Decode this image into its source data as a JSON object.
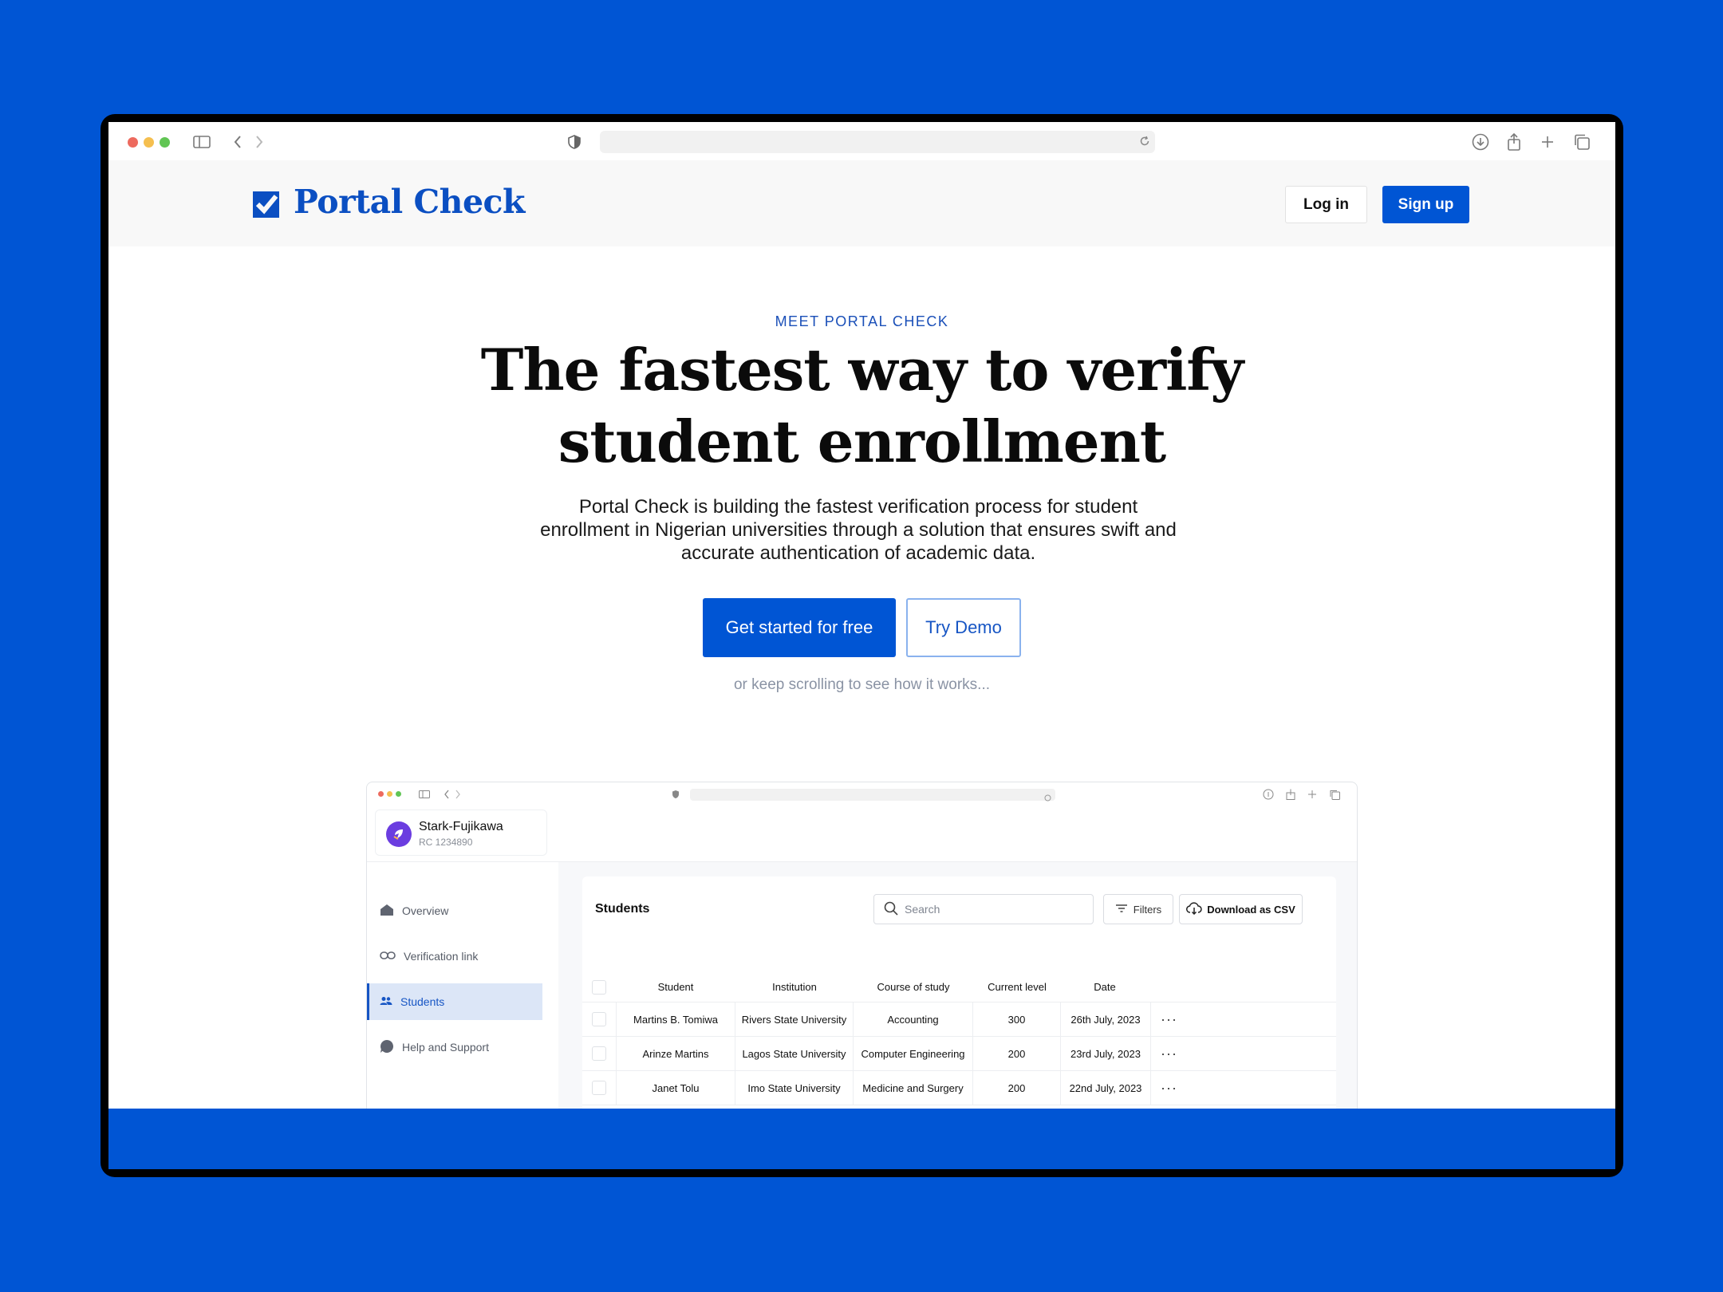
{
  "site": {
    "brand": "Portal Check",
    "nav": {
      "login_label": "Log in",
      "signup_label": "Sign up"
    }
  },
  "hero": {
    "eyebrow": "MEET PORTAL CHECK",
    "headline_line1": "The fastest way to verify",
    "headline_line2": "student enrollment",
    "subcopy": "Portal Check is building the fastest verification process for student enrollment in Nigerian universities through a solution that ensures swift and accurate authentication of academic data.",
    "cta_primary": "Get started for free",
    "cta_secondary": "Try Demo",
    "scroll_hint": "or keep scrolling to see how it works..."
  },
  "app": {
    "org": {
      "name": "Stark-Fujikawa",
      "rc": "RC 1234890"
    },
    "sidebar": [
      {
        "label": "Overview",
        "icon": "home-icon"
      },
      {
        "label": "Verification link",
        "icon": "link-icon"
      },
      {
        "label": "Students",
        "icon": "users-icon",
        "active": true
      },
      {
        "label": "Help and Support",
        "icon": "chat-icon"
      }
    ],
    "students": {
      "title": "Students",
      "search_placeholder": "Search",
      "filters_label": "Filters",
      "download_label": "Download as CSV",
      "columns": [
        "Student",
        "Institution",
        "Course of study",
        "Current level",
        "Date"
      ],
      "rows": [
        [
          "Martins B. Tomiwa",
          "Rivers State University",
          "Accounting",
          "300",
          "26th July, 2023"
        ],
        [
          "Arinze Martins",
          "Lagos State University",
          "Computer Engineering",
          "200",
          "23rd July, 2023"
        ],
        [
          "Janet Tolu",
          "Imo State University",
          "Medicine and Surgery",
          "200",
          "22nd July, 2023"
        ]
      ],
      "more_glyph": "···"
    }
  },
  "colors": {
    "brand_blue": "#0055d4",
    "logo_blue": "#0b4fc2",
    "avatar_purple": "#6b3de0"
  }
}
